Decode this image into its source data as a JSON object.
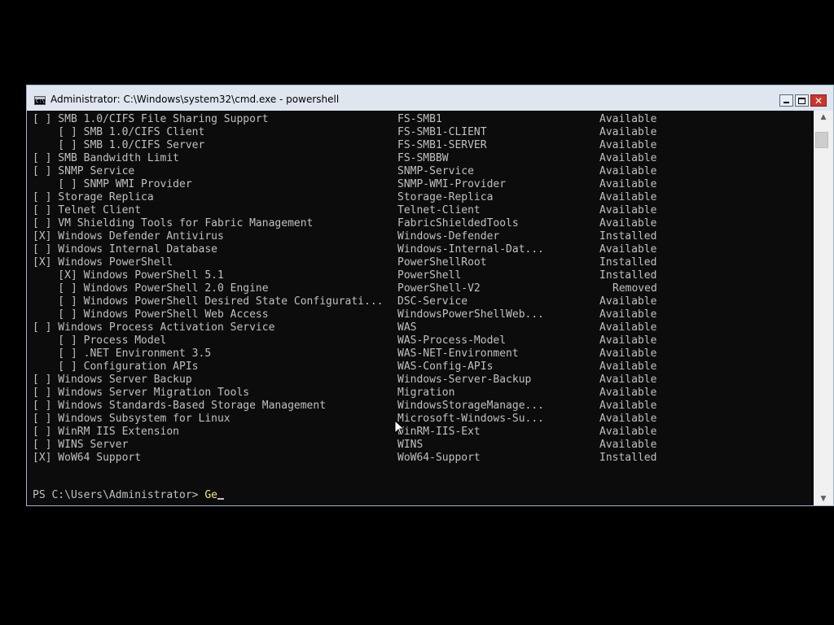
{
  "window": {
    "title": "Administrator: C:\\Windows\\system32\\cmd.exe - powershell",
    "close_glyph": "✕",
    "icon_text": "C:\\"
  },
  "features": [
    {
      "name": "[ ] SMB 1.0/CIFS File Sharing Support",
      "short": "FS-SMB1",
      "state": "Available"
    },
    {
      "name": "    [ ] SMB 1.0/CIFS Client",
      "short": "FS-SMB1-CLIENT",
      "state": "Available"
    },
    {
      "name": "    [ ] SMB 1.0/CIFS Server",
      "short": "FS-SMB1-SERVER",
      "state": "Available"
    },
    {
      "name": "[ ] SMB Bandwidth Limit",
      "short": "FS-SMBBW",
      "state": "Available"
    },
    {
      "name": "[ ] SNMP Service",
      "short": "SNMP-Service",
      "state": "Available"
    },
    {
      "name": "    [ ] SNMP WMI Provider",
      "short": "SNMP-WMI-Provider",
      "state": "Available"
    },
    {
      "name": "[ ] Storage Replica",
      "short": "Storage-Replica",
      "state": "Available"
    },
    {
      "name": "[ ] Telnet Client",
      "short": "Telnet-Client",
      "state": "Available"
    },
    {
      "name": "[ ] VM Shielding Tools for Fabric Management",
      "short": "FabricShieldedTools",
      "state": "Available"
    },
    {
      "name": "[X] Windows Defender Antivirus",
      "short": "Windows-Defender",
      "state": "Installed"
    },
    {
      "name": "[ ] Windows Internal Database",
      "short": "Windows-Internal-Dat...",
      "state": "Available"
    },
    {
      "name": "[X] Windows PowerShell",
      "short": "PowerShellRoot",
      "state": "Installed"
    },
    {
      "name": "    [X] Windows PowerShell 5.1",
      "short": "PowerShell",
      "state": "Installed"
    },
    {
      "name": "    [ ] Windows PowerShell 2.0 Engine",
      "short": "PowerShell-V2",
      "state": "Removed"
    },
    {
      "name": "    [ ] Windows PowerShell Desired State Configurati...",
      "short": "DSC-Service",
      "state": "Available"
    },
    {
      "name": "    [ ] Windows PowerShell Web Access",
      "short": "WindowsPowerShellWeb...",
      "state": "Available"
    },
    {
      "name": "[ ] Windows Process Activation Service",
      "short": "WAS",
      "state": "Available"
    },
    {
      "name": "    [ ] Process Model",
      "short": "WAS-Process-Model",
      "state": "Available"
    },
    {
      "name": "    [ ] .NET Environment 3.5",
      "short": "WAS-NET-Environment",
      "state": "Available"
    },
    {
      "name": "    [ ] Configuration APIs",
      "short": "WAS-Config-APIs",
      "state": "Available"
    },
    {
      "name": "[ ] Windows Server Backup",
      "short": "Windows-Server-Backup",
      "state": "Available"
    },
    {
      "name": "[ ] Windows Server Migration Tools",
      "short": "Migration",
      "state": "Available"
    },
    {
      "name": "[ ] Windows Standards-Based Storage Management",
      "short": "WindowsStorageManage...",
      "state": "Available"
    },
    {
      "name": "[ ] Windows Subsystem for Linux",
      "short": "Microsoft-Windows-Su...",
      "state": "Available"
    },
    {
      "name": "[ ] WinRM IIS Extension",
      "short": "WinRM-IIS-Ext",
      "state": "Available"
    },
    {
      "name": "[ ] WINS Server",
      "short": "WINS",
      "state": "Available"
    },
    {
      "name": "[X] WoW64 Support",
      "short": "WoW64-Support",
      "state": "Installed"
    }
  ],
  "prompt": {
    "path": "PS C:\\Users\\Administrator> ",
    "typed": "Ge"
  },
  "scrollbar": {
    "up_glyph": "▲",
    "down_glyph": "▼"
  },
  "colors": {
    "console_bg": "#0c0c0c",
    "console_fg": "#c0c0c0",
    "typed_text": "#f0e68c",
    "titlebar": "#dfe6ef",
    "close_button": "#c7372d"
  },
  "icons": {
    "app": "cmd-icon",
    "minimize": "minimize-icon",
    "maximize": "maximize-icon",
    "close": "close-icon",
    "pointer": "text-cursor-icon"
  }
}
